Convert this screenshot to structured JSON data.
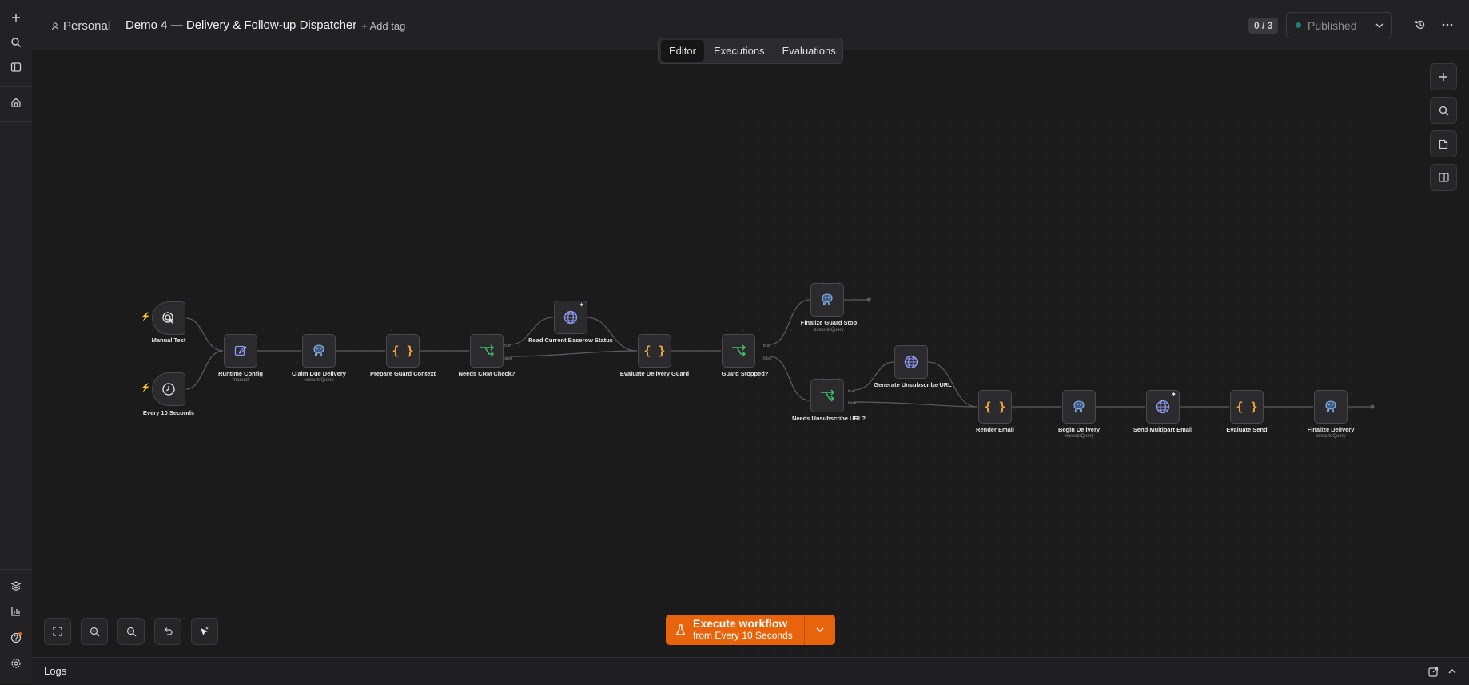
{
  "header": {
    "project": "Personal",
    "workflow_title": "Demo 4 — Delivery & Follow-up Dispatcher",
    "add_tag": "+ Add tag",
    "counter": "0 / 3",
    "publish_status": "Published"
  },
  "tabs": [
    "Editor",
    "Executions",
    "Evaluations"
  ],
  "nodes": {
    "manual_test": {
      "label": "Manual Test",
      "icon": "cursor-click-icon"
    },
    "every_10_seconds": {
      "label": "Every 10 Seconds",
      "icon": "clock-icon"
    },
    "runtime_config": {
      "label": "Runtime Config",
      "sub": "manual",
      "icon": "edit-icon"
    },
    "claim_due_delivery": {
      "label": "Claim Due Delivery",
      "sub": "executeQuery",
      "icon": "postgres-icon"
    },
    "prepare_guard_context": {
      "label": "Prepare Guard Context",
      "icon": "code-braces-icon"
    },
    "needs_crm_check": {
      "label": "Needs CRM Check?",
      "icon": "if-branch-icon",
      "true": "true",
      "false": "false"
    },
    "read_current_baserow_status": {
      "label": "Read Current Baserow Status",
      "icon": "globe-icon"
    },
    "evaluate_delivery_guard": {
      "label": "Evaluate Delivery Guard",
      "icon": "code-braces-icon"
    },
    "guard_stopped": {
      "label": "Guard Stopped?",
      "icon": "if-branch-icon",
      "true": "true",
      "false": "false"
    },
    "finalize_guard_stop": {
      "label": "Finalize Guard Stop",
      "sub": "executeQuery",
      "icon": "postgres-icon"
    },
    "needs_unsubscribe_url": {
      "label": "Needs Unsubscribe URL?",
      "icon": "if-branch-icon",
      "true": "true",
      "false": "false"
    },
    "generate_unsubscribe_url": {
      "label": "Generate Unsubscribe URL",
      "icon": "globe-icon"
    },
    "render_email": {
      "label": "Render Email",
      "icon": "code-braces-icon"
    },
    "begin_delivery": {
      "label": "Begin Delivery",
      "sub": "executeQuery",
      "icon": "postgres-icon"
    },
    "send_multipart_email": {
      "label": "Send Multipart Email",
      "icon": "globe-icon"
    },
    "evaluate_send": {
      "label": "Evaluate Send",
      "icon": "code-braces-icon"
    },
    "finalize_delivery": {
      "label": "Finalize Delivery",
      "sub": "executeQuery",
      "icon": "postgres-icon"
    }
  },
  "execute": {
    "label": "Execute workflow",
    "sub": "from Every 10 Seconds"
  },
  "logs_label": "Logs",
  "colors": {
    "accent": "#e8640c",
    "code_icon": "#f0a53a",
    "if_icon": "#3fbf6a",
    "http_icon": "#8f9cf7",
    "published_dot": "#1e7c76"
  }
}
